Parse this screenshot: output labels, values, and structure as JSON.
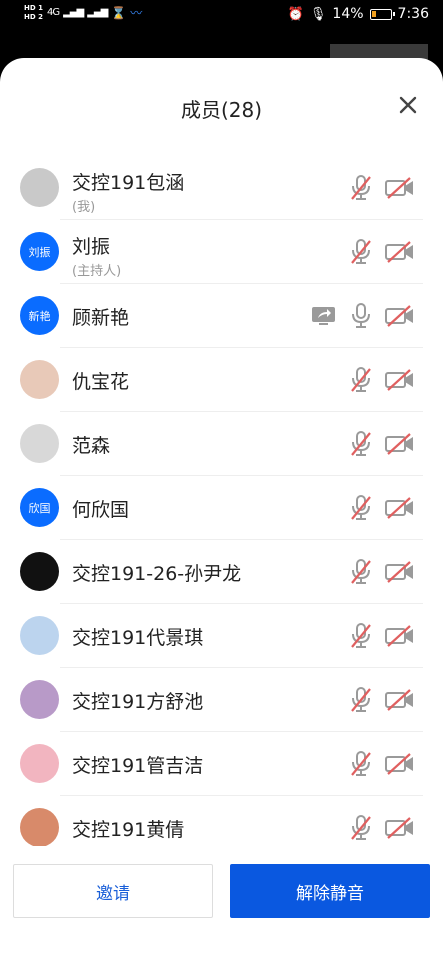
{
  "status": {
    "sim1": "HD 1",
    "sim2": "HD 2",
    "net": "4G",
    "battery": "14%",
    "time": "7:36"
  },
  "sheet": {
    "title": "成员(28)"
  },
  "members": [
    {
      "name": "交控191包涵",
      "role": "(我)",
      "avatar_text": "",
      "avatar_color": "#c9c9c9",
      "mic_muted": true,
      "cam_off": true,
      "sharing": false
    },
    {
      "name": "刘振",
      "role": "(主持人)",
      "avatar_text": "刘振",
      "avatar_color": "#0a6cff",
      "mic_muted": true,
      "cam_off": true,
      "sharing": false
    },
    {
      "name": "顾新艳",
      "role": "",
      "avatar_text": "新艳",
      "avatar_color": "#0a6cff",
      "mic_muted": false,
      "cam_off": true,
      "sharing": true
    },
    {
      "name": "仇宝花",
      "role": "",
      "avatar_text": "",
      "avatar_color": "#e8c9b8",
      "mic_muted": true,
      "cam_off": true,
      "sharing": false
    },
    {
      "name": "范森",
      "role": "",
      "avatar_text": "",
      "avatar_color": "#d8d8d8",
      "mic_muted": true,
      "cam_off": true,
      "sharing": false
    },
    {
      "name": "何欣国",
      "role": "",
      "avatar_text": "欣国",
      "avatar_color": "#0a6cff",
      "mic_muted": true,
      "cam_off": true,
      "sharing": false
    },
    {
      "name": "交控191-26-孙尹龙",
      "role": "",
      "avatar_text": "",
      "avatar_color": "#111111",
      "mic_muted": true,
      "cam_off": true,
      "sharing": false
    },
    {
      "name": "交控191代景琪",
      "role": "",
      "avatar_text": "",
      "avatar_color": "#bcd4ee",
      "mic_muted": true,
      "cam_off": true,
      "sharing": false
    },
    {
      "name": "交控191方舒池",
      "role": "",
      "avatar_text": "",
      "avatar_color": "#b89ac8",
      "mic_muted": true,
      "cam_off": true,
      "sharing": false
    },
    {
      "name": "交控191管吉洁",
      "role": "",
      "avatar_text": "",
      "avatar_color": "#f2b5c0",
      "mic_muted": true,
      "cam_off": true,
      "sharing": false
    },
    {
      "name": "交控191黄倩",
      "role": "",
      "avatar_text": "",
      "avatar_color": "#d88a6a",
      "mic_muted": true,
      "cam_off": true,
      "sharing": false
    }
  ],
  "buttons": {
    "invite": "邀请",
    "unmute": "解除静音"
  },
  "colors": {
    "accent": "#0a58e0",
    "muted_icon": "#e06060",
    "icon_gray": "#9a9a9a"
  }
}
